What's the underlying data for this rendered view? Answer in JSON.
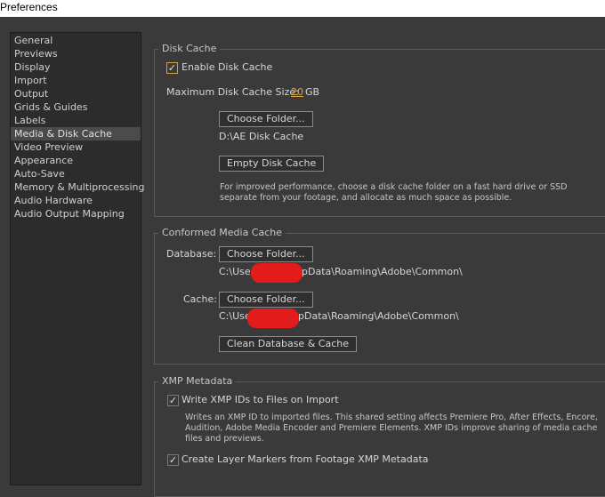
{
  "window": {
    "title": "Preferences"
  },
  "sidebar": {
    "items": [
      {
        "label": "General"
      },
      {
        "label": "Previews"
      },
      {
        "label": "Display"
      },
      {
        "label": "Import"
      },
      {
        "label": "Output"
      },
      {
        "label": "Grids & Guides"
      },
      {
        "label": "Labels"
      },
      {
        "label": "Media & Disk Cache",
        "selected": true
      },
      {
        "label": "Video Preview"
      },
      {
        "label": "Appearance"
      },
      {
        "label": "Auto-Save"
      },
      {
        "label": "Memory & Multiprocessing"
      },
      {
        "label": "Audio Hardware"
      },
      {
        "label": "Audio Output Mapping"
      }
    ]
  },
  "disk_cache": {
    "title": "Disk Cache",
    "enable_label": "Enable Disk Cache",
    "enable_checked": true,
    "max_size_label": "Maximum Disk Cache Size:",
    "max_size_value": "20",
    "max_size_unit": "GB",
    "choose_folder_label": "Choose Folder...",
    "folder_path": "D:\\AE Disk Cache",
    "empty_cache_label": "Empty Disk Cache",
    "note": "For improved performance, choose a disk cache folder on a fast hard drive or SSD separate from your footage, and allocate as much space as possible."
  },
  "conformed_media": {
    "title": "Conformed Media Cache",
    "database_label": "Database:",
    "database_button": "Choose Folder...",
    "database_path_start": "C:\\Use",
    "database_path_end": "pData\\Roaming\\Adobe\\Common\\",
    "cache_label": "Cache:",
    "cache_button": "Choose Folder...",
    "cache_path_start": "C:\\Use",
    "cache_path_end": "pData\\Roaming\\Adobe\\Common\\",
    "clean_label": "Clean Database & Cache"
  },
  "xmp": {
    "title": "XMP Metadata",
    "write_ids_label": "Write XMP IDs to Files on Import",
    "write_ids_checked": true,
    "write_ids_note": "Writes an XMP ID to imported files. This shared setting affects Premiere Pro, After Effects, Encore, Audition, Adobe Media Encoder and Premiere Elements. XMP IDs improve sharing of media cache files and previews.",
    "layer_markers_label": "Create Layer Markers from Footage XMP Metadata",
    "layer_markers_checked": true
  },
  "icons": {
    "checkmark": "checkmark-icon"
  },
  "colors": {
    "accent": "#e8a33b",
    "redaction": "#e31b1b"
  }
}
